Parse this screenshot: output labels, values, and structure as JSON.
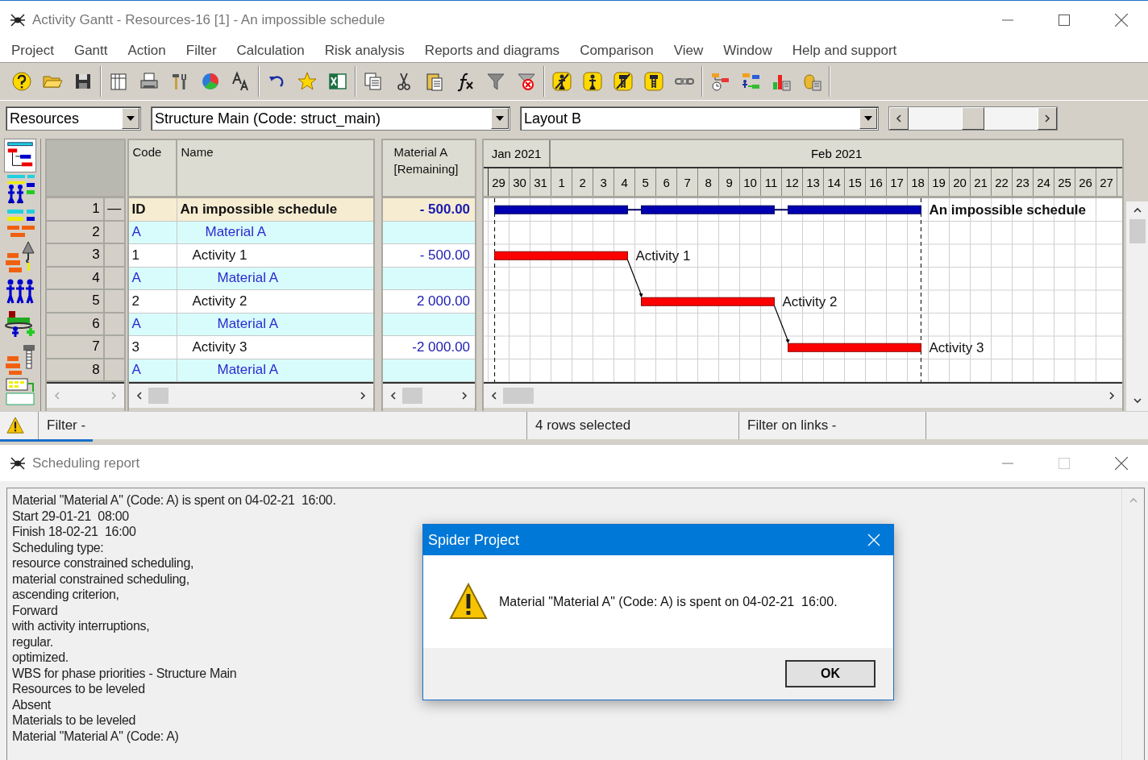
{
  "window": {
    "title": "Activity Gantt - Resources-16 [1] - An impossible schedule"
  },
  "menu": [
    "Project",
    "Gantt",
    "Action",
    "Filter",
    "Calculation",
    "Risk analysis",
    "Reports and diagrams",
    "Comparison",
    "View",
    "Window",
    "Help and support"
  ],
  "selectors": [
    {
      "value": "Resources"
    },
    {
      "value": "Structure Main (Code: struct_main)"
    },
    {
      "value": "Layout B"
    }
  ],
  "table": {
    "columns": [
      "Code",
      "Name",
      "Material A [Remaining]"
    ],
    "rows": [
      {
        "number": "1",
        "toggle": "—",
        "code": "ID",
        "name": "An impossible schedule",
        "remaining": "- 500.00",
        "kind": "summary",
        "bar_label": "An impossible schedule",
        "children": [
          {
            "number": "2",
            "code": "A",
            "name": "Material A",
            "kind": "material"
          },
          {
            "number": "3",
            "code": "1",
            "name": "Activity 1",
            "remaining": "- 500.00",
            "kind": "activity",
            "bar_label": "Activity 1",
            "children": [
              {
                "number": "4",
                "code": "A",
                "name": "Material A",
                "kind": "material"
              }
            ]
          },
          {
            "number": "5",
            "code": "2",
            "name": "Activity 2",
            "remaining": "2 000.00",
            "kind": "activity",
            "bar_label": "Activity 2",
            "children": [
              {
                "number": "6",
                "code": "A",
                "name": "Material A",
                "kind": "material"
              }
            ]
          },
          {
            "number": "7",
            "code": "3",
            "name": "Activity 3",
            "remaining": "-2 000.00",
            "kind": "activity",
            "bar_label": "Activity 3",
            "children": [
              {
                "number": "8",
                "code": "A",
                "name": "Material A",
                "kind": "material"
              }
            ]
          }
        ]
      }
    ]
  },
  "gantt": {
    "months": [
      "Jan 2021",
      "Feb 2021"
    ],
    "days": [
      "29",
      "30",
      "31",
      "1",
      "2",
      "3",
      "4",
      "5",
      "6",
      "7",
      "8",
      "9",
      "10",
      "11",
      "12",
      "13",
      "14",
      "15",
      "16",
      "17",
      "18",
      "19",
      "20",
      "21",
      "22",
      "23",
      "24",
      "25",
      "26",
      "27"
    ]
  },
  "status_bar": [
    "Filter -",
    "4 rows selected",
    "Filter on links -"
  ],
  "report": {
    "title": "Scheduling report",
    "lines": [
      "Material \"Material A\" (Code: A) is spent on 04-02-21  16:00.",
      "Start 29-01-21  08:00",
      "Finish 18-02-21  16:00",
      "Scheduling type:",
      "resource constrained scheduling,",
      "material constrained scheduling,",
      "ascending criterion,",
      "Forward",
      "with activity interruptions,",
      "regular.",
      "optimized.",
      "WBS for phase priorities - Structure Main",
      "Resources to be leveled",
      "Absent",
      "Materials to be leveled",
      "Material \"Material A\" (Code: A)"
    ]
  },
  "dialog": {
    "title": "Spider Project",
    "message": "Material \"Material A\" (Code: A) is spent on 04-02-21  16:00.",
    "button": "OK"
  }
}
